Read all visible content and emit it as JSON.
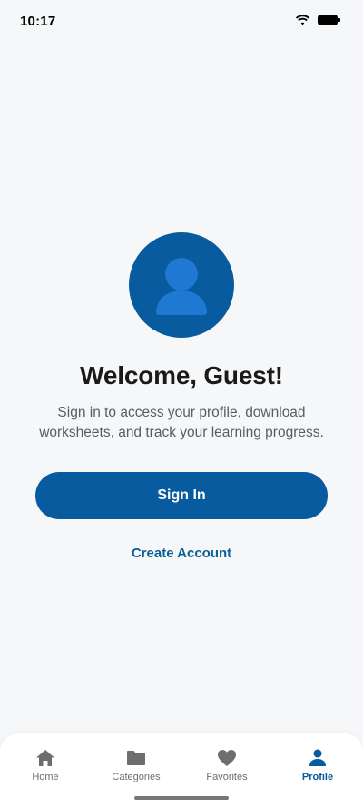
{
  "status_bar": {
    "time": "10:17",
    "icons": [
      "wifi-icon",
      "battery-icon"
    ]
  },
  "profile": {
    "avatar_icon": "user-icon",
    "title": "Welcome, Guest!",
    "subtitle": "Sign in to access your profile, download worksheets, and track your learning progress.",
    "sign_in_label": "Sign In",
    "create_account_label": "Create Account"
  },
  "tab_bar": {
    "active": "Profile",
    "items": [
      {
        "label": "Home",
        "icon": "home-icon"
      },
      {
        "label": "Categories",
        "icon": "folder-icon"
      },
      {
        "label": "Favorites",
        "icon": "heart-icon"
      },
      {
        "label": "Profile",
        "icon": "person-icon"
      }
    ]
  },
  "colors": {
    "primary": "#075b9e",
    "avatar_glyph": "#1f78d1",
    "background": "#f6f7f9",
    "tab_inactive": "#6e6e6e"
  }
}
